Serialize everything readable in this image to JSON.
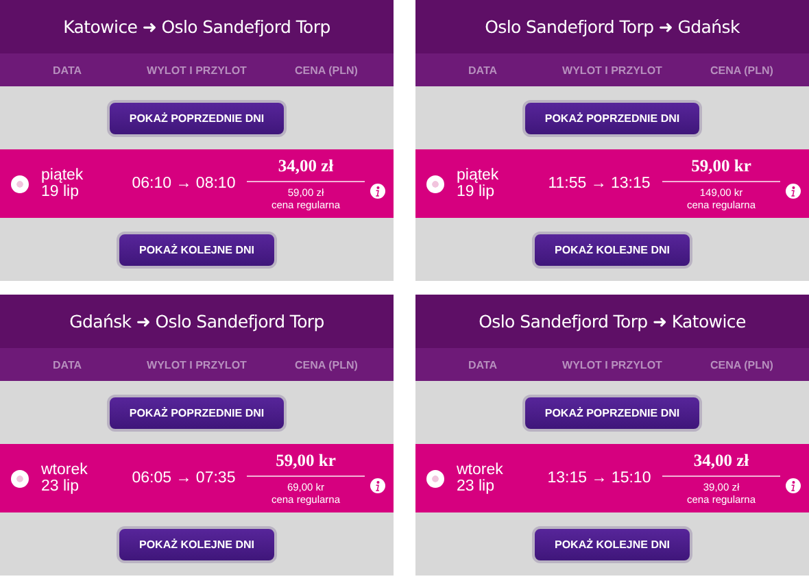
{
  "panels": [
    {
      "title": "Katowice ➜ Oslo Sandefjord Torp",
      "columns": [
        "DATA",
        "WYLOT I PRZYLOT",
        "CENA (PLN)"
      ],
      "prev_button": "POKAŻ POPRZEDNIE DNI",
      "flight": {
        "selected": false,
        "day": "piątek",
        "date": "19 lip",
        "times": "06:10 → 08:10",
        "price": "34,00 zł",
        "regular_price": "59,00 zł",
        "regular_label": "cena regularna"
      },
      "next_button": "POKAŻ KOLEJNE DNI"
    },
    {
      "title": "Oslo Sandefjord Torp ➜ Gdańsk",
      "columns": [
        "DATA",
        "WYLOT I PRZYLOT",
        "CENA (PLN)"
      ],
      "prev_button": "POKAŻ POPRZEDNIE DNI",
      "flight": {
        "selected": false,
        "day": "piątek",
        "date": "19 lip",
        "times": "11:55 → 13:15",
        "price": "59,00 kr",
        "regular_price": "149,00 kr",
        "regular_label": "cena regularna"
      },
      "next_button": "POKAŻ KOLEJNE DNI"
    },
    {
      "title": "Gdańsk ➜ Oslo Sandefjord Torp",
      "columns": [
        "DATA",
        "WYLOT I PRZYLOT",
        "CENA (PLN)"
      ],
      "prev_button": "POKAŻ POPRZEDNIE DNI",
      "flight": {
        "selected": false,
        "day": "wtorek",
        "date": "23 lip",
        "times": "06:05 → 07:35",
        "price": "59,00 kr",
        "regular_price": "69,00 kr",
        "regular_label": "cena regularna"
      },
      "next_button": "POKAŻ KOLEJNE DNI"
    },
    {
      "title": "Oslo Sandefjord Torp ➜ Katowice",
      "columns": [
        "DATA",
        "WYLOT I PRZYLOT",
        "CENA (PLN)"
      ],
      "prev_button": "POKAŻ POPRZEDNIE DNI",
      "flight": {
        "selected": false,
        "day": "wtorek",
        "date": "23 lip",
        "times": "13:15 → 15:10",
        "price": "34,00 zł",
        "regular_price": "39,00 zł",
        "regular_label": "cena regularna"
      },
      "next_button": "POKAŻ KOLEJNE DNI"
    }
  ]
}
